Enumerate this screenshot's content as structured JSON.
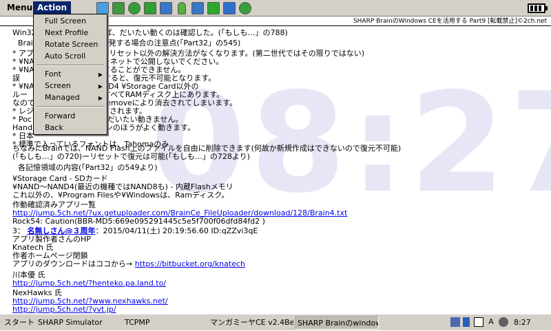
{
  "menubar": {
    "menu_label": "Menu",
    "action_label": "Action"
  },
  "toolbar": {
    "icons": [
      "folder-open-icon",
      "refresh-folder-icon",
      "search-icon",
      "back-arrow-icon",
      "bookmark-icon",
      "bottle-icon",
      "image-icon",
      "down-arrow-icon",
      "text-a-icon",
      "link-icon"
    ],
    "colors": [
      "#4a9fe0",
      "#3c9a3c",
      "#34a034",
      "#30a030",
      "#3a78c8",
      "#58b040",
      "#3a78c8",
      "#2ea82e",
      "#2e6fd0",
      "#38a038"
    ]
  },
  "window": {
    "title": "SHARP BrainのWindows CEを活用する Part9 [転載禁止]©2ch.net"
  },
  "watermark": {
    "clock": "08:27",
    "color": "#e6e6f6"
  },
  "dropdown": {
    "items": [
      "Full Screen",
      "Next Profile",
      "Rotate Screen",
      "Auto Scroll",
      "Font",
      "Screen",
      "Managed",
      "Forward",
      "Back"
    ]
  },
  "content": {
    "lines": [
      "Win32　　　　　　が動けば、だいたい動くのは確認した。(「もしも…」の788)",
      "Brain　　　　　　かす/開発する場合の注意点(「Part32」の545)",
      "* アプリ　　　　　すると、リセット以外の解決方法がなくなります。(第二世代ではその限りではない)",
      "* ¥NA　　　　　　インターネットで公開しないでください。",
      "* ¥NA　　　　　　を追加することができません。",
      "誤　　　　　　　　を削除すると、復元不可能となります。",
      "* ¥NA　　　　　　3 ¥NAND4 ¥Storage Card以外の",
      "ルー　　　　　　　ルは、すべてRAMディスク上にあります。",
      "なので　　　　　　テリーremoveにより消去されてしまいます。",
      "* レジ　　　　　　リセットされます。",
      "* Poc　　　　　　ションはだいたい動きません。",
      "Handh　　　　　　ーションのほうがよく動きます。",
      "* 日本",
      "* 標準で入っているフォントは、Tahomaのみ",
      "ちなみにBrainでは、NAND Flash上のファイルを自由に削除できます(何故か新規作成はできないので復元不可能)",
      "(「もしも…」の720)ーリセットで復元は可能(「もしも…」の728より)",
      "各記憶領域の内容(「Part32」の549より)",
      "¥Storage Card - SDカード",
      "¥NAND〜NAND4(最近の機種ではNAND8も) - 内蔵Flashメモリ",
      "これ以外の、¥Program Filesや¥Windowsは、Ramディスク。",
      "作動確認済みアプリ一覧",
      "http://jump.5ch.net/?ux.getuploader.com/BrainCe_FileUploader/download/128/Brain4.txt",
      "Rock54: Caution(BBR-MD5:669e095291445c5e5f700f06dfd84fd2 )",
      "アプリ製作者さんのHP",
      "Knatech 氏",
      "作者ホームページ閉鎖",
      "アプリのダウンロードはココから→ ",
      "https://bitbucket.org/knatech",
      "川本優 氏",
      "http://jump.5ch.net/?henteko.pa.land.to/",
      "NexHawks 氏",
      "http://jump.5ch.net/?www.nexhawks.net/",
      "http://jump.5ch.net/?yvt.jp/"
    ],
    "post": {
      "number": "3：",
      "name": "名無しさん@３周年",
      "date": "：2015/04/11(土) 20:19:56.60 ID:qZZvi3qE"
    }
  },
  "taskbar": {
    "start": "スタート",
    "buttons": [
      "SHARP Simulator",
      "TCPMP",
      "マンガミーヤCE v2.4Beta",
      "SHARP Brainのwindow"
    ],
    "tray": [
      "network-icon",
      "flag-icon",
      "display-icon",
      "ime-a-icon",
      "volume-icon"
    ],
    "time": "8:27"
  }
}
